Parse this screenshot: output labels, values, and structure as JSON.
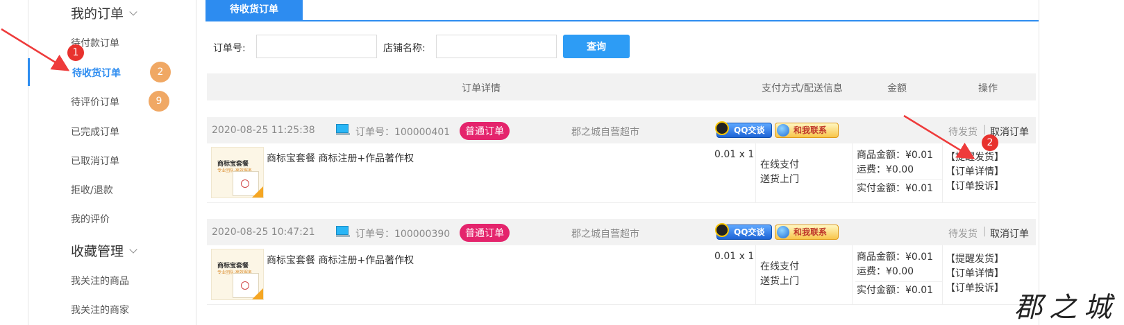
{
  "sidebar": {
    "section_orders": "我的订单",
    "items_orders": [
      {
        "label": "待付款订单"
      },
      {
        "label": "待收货订单",
        "badge": "2"
      },
      {
        "label": "待评价订单",
        "badge": "9"
      },
      {
        "label": "已完成订单"
      },
      {
        "label": "已取消订单"
      },
      {
        "label": "拒收/退款"
      },
      {
        "label": "我的评价"
      }
    ],
    "section_favorites": "收藏管理",
    "items_favorites": [
      {
        "label": "我关注的商品"
      },
      {
        "label": "我关注的商家"
      }
    ]
  },
  "tab": {
    "label": "待收货订单"
  },
  "filter": {
    "order_no_label": "订单号:",
    "order_no_value": "",
    "shop_name_label": "店铺名称:",
    "shop_name_value": "",
    "search_label": "查询"
  },
  "table_headers": [
    "订单详情",
    "支付方式/配送信息",
    "金额",
    "操作"
  ],
  "orders": [
    {
      "date": "2020-08-25 11:25:38",
      "order_no": "订单号：100000401",
      "type": "普通订单",
      "shop": "郡之城自营超市",
      "qq_label": "QQ交谈",
      "contact_label": "和我联系",
      "status": "待发货",
      "separator": "|",
      "cancel": "取消订单",
      "thumb_title": "商标宝套餐",
      "thumb_sub": "专业团队·高效服务",
      "goods_name": "商标宝套餐 商标注册+作品著作权",
      "price_qty": "0.01 x 1",
      "pay_method": "在线支付",
      "delivery": "送货上门",
      "goods_amount": "商品金额：¥0.01",
      "freight": "运费：¥0.00",
      "paid_amount": "实付金额：¥0.01",
      "actions": [
        "【提醒发货】",
        "【订单详情】",
        "【订单投诉】"
      ]
    },
    {
      "date": "2020-08-25 10:47:21",
      "order_no": "订单号：100000390",
      "type": "普通订单",
      "shop": "郡之城自营超市",
      "qq_label": "QQ交谈",
      "contact_label": "和我联系",
      "status": "待发货",
      "separator": "|",
      "cancel": "取消订单",
      "thumb_title": "商标宝套餐",
      "thumb_sub": "专业团队·高效服务",
      "goods_name": "商标宝套餐 商标注册+作品著作权",
      "price_qty": "0.01 x 1",
      "pay_method": "在线支付",
      "delivery": "送货上门",
      "goods_amount": "商品金额：¥0.01",
      "freight": "运费：¥0.00",
      "paid_amount": "实付金额：¥0.01",
      "actions": [
        "【提醒发货】",
        "【订单详情】",
        "【订单投诉】"
      ]
    }
  ],
  "annotations": {
    "step_1": "1",
    "step_2": "2"
  },
  "watermark": "郡之城",
  "colors": {
    "accent": "#2d8cf0",
    "badge": "#f0a864",
    "order_type": "#e4246c",
    "annotation": "#e8322e"
  }
}
